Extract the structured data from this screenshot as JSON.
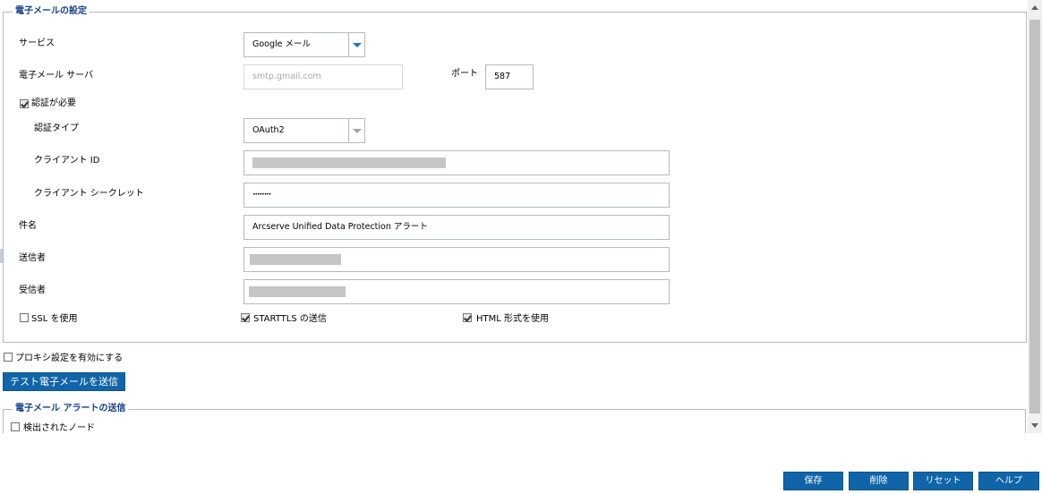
{
  "email_settings": {
    "legend": "電子メールの設定",
    "service": {
      "label": "サービス",
      "value": "Google メール"
    },
    "server": {
      "label": "電子メール サーバ",
      "placeholder": "smtp.gmail.com"
    },
    "port": {
      "label": "ポート",
      "value": "587"
    },
    "auth_required": {
      "label": "認証が必要",
      "checked": true
    },
    "auth_type": {
      "label": "認証タイプ",
      "value": "OAuth2"
    },
    "client_id": {
      "label": "クライアント ID"
    },
    "client_secret": {
      "label": "クライアント シークレット",
      "value": "••••••••"
    },
    "subject": {
      "label": "件名",
      "value": "Arcserve Unified Data Protection アラート"
    },
    "sender": {
      "label": "送信者"
    },
    "recipient": {
      "label": "受信者"
    },
    "use_ssl": {
      "label": "SSL を使用",
      "checked": false
    },
    "starttls": {
      "label": "STARTTLS の送信",
      "checked": true
    },
    "html_format": {
      "label": "HTML 形式を使用",
      "checked": true
    }
  },
  "proxy": {
    "label": "プロキシ設定を有効にする",
    "checked": false
  },
  "test_button": "テスト電子メールを送信",
  "alerts": {
    "legend": "電子メール アラートの送信",
    "detected_nodes": {
      "label": "検出されたノード",
      "checked": false
    }
  },
  "footer": {
    "save": "保存",
    "delete": "削除",
    "reset": "リセット",
    "help": "ヘルプ"
  },
  "colors": {
    "accent": "#1065a8",
    "legend": "#15428b",
    "border": "#b5b8c8"
  }
}
